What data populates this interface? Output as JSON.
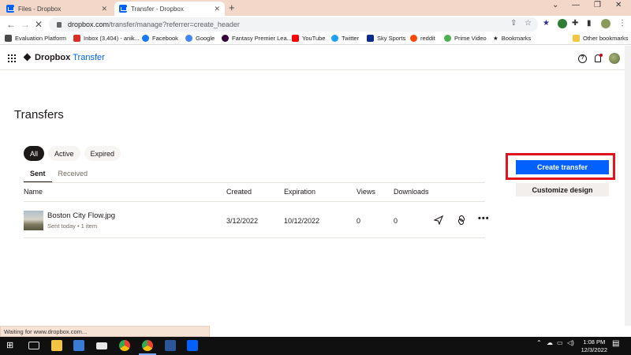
{
  "browser": {
    "tabs": [
      {
        "title": "Files - Dropbox"
      },
      {
        "title": "Transfer - Dropbox"
      }
    ],
    "url": {
      "host": "dropbox.com",
      "path": "/transfer/manage?referrer=create_header"
    },
    "bookmarks": [
      {
        "label": "Evaluation Platform",
        "icon": "eval-icon",
        "color": "#4a4a4a"
      },
      {
        "label": "Inbox (3,404) - anik...",
        "icon": "gmail-icon",
        "color": "#d93025"
      },
      {
        "label": "Facebook",
        "icon": "facebook-icon",
        "color": "#1877f2"
      },
      {
        "label": "Google",
        "icon": "google-icon",
        "color": "#4285f4"
      },
      {
        "label": "Fantasy Premier Lea...",
        "icon": "fpl-icon",
        "color": "#37003c"
      },
      {
        "label": "YouTube",
        "icon": "youtube-icon",
        "color": "#ff0000"
      },
      {
        "label": "Twitter",
        "icon": "twitter-icon",
        "color": "#1da1f2"
      },
      {
        "label": "Sky Sports",
        "icon": "skysports-icon",
        "color": "#0a2a8c"
      },
      {
        "label": "reddit",
        "icon": "reddit-icon",
        "color": "#ff4500"
      },
      {
        "label": "Prime Video",
        "icon": "primevideo-icon",
        "color": "#4caf50"
      },
      {
        "label": "Bookmarks",
        "icon": "star-icon",
        "color": "#202124"
      }
    ],
    "other_bookmarks": "Other bookmarks",
    "status": "Waiting for www.dropbox.com..."
  },
  "app": {
    "brand": "Dropbox",
    "product": "Transfer",
    "accent": "#0061fe"
  },
  "page": {
    "title": "Transfers",
    "filters": [
      "All",
      "Active",
      "Expired"
    ],
    "subtabs": [
      "Sent",
      "Received"
    ],
    "columns": {
      "name": "Name",
      "created": "Created",
      "expiration": "Expiration",
      "views": "Views",
      "downloads": "Downloads"
    },
    "rows": [
      {
        "name": "Boston City Flow.jpg",
        "meta": "Sent today • 1 item",
        "created": "3/12/2022",
        "expiration": "10/12/2022",
        "views": "0",
        "downloads": "0"
      }
    ],
    "actions": {
      "create": "Create transfer",
      "customize": "Customize design"
    }
  },
  "taskbar": {
    "time": "1:08 PM",
    "date": "12/3/2022"
  }
}
